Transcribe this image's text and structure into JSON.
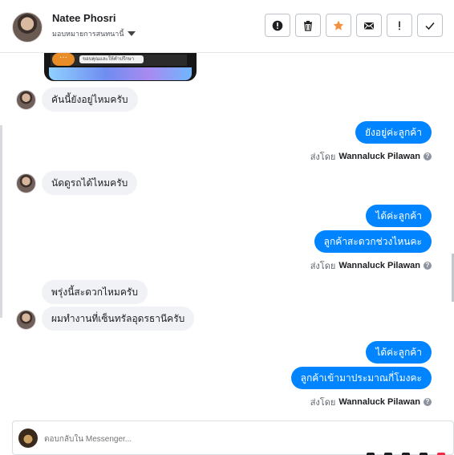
{
  "header": {
    "name": "Natee Phosri",
    "assign_label": "มอบหมายการสนทนานี้",
    "actions": [
      {
        "name": "report-icon",
        "glyph": "!"
      },
      {
        "name": "trash-icon"
      },
      {
        "name": "star-icon",
        "color": "#f5913e"
      },
      {
        "name": "mail-icon"
      },
      {
        "name": "exclamation-icon",
        "glyph": "!"
      },
      {
        "name": "check-icon"
      }
    ]
  },
  "thread": {
    "image_preview": {
      "chip_text": "ขอบคุณและให้คำปรึกษา"
    },
    "messages": [
      {
        "side": "in",
        "text": "คันนี้ยังอยู่ไหมครับ",
        "avatar": true
      },
      {
        "side": "out",
        "text": "ยังอยู่ค่ะลูกค้า"
      },
      {
        "side": "sent_by",
        "prefix": "ส่งโดย",
        "who": "Wannaluck Pilawan"
      },
      {
        "side": "in",
        "text": "นัดดูรถได้ไหมครับ",
        "avatar": true
      },
      {
        "side": "out",
        "text": "ได้ค่ะลูกค้า"
      },
      {
        "side": "out",
        "text": "ลูกค้าสะดวกช่วงไหนคะ"
      },
      {
        "side": "sent_by",
        "prefix": "ส่งโดย",
        "who": "Wannaluck Pilawan"
      },
      {
        "side": "in",
        "text": "พรุ่งนี้สะดวกไหมครับ",
        "avatar": false
      },
      {
        "side": "in",
        "text": "ผมทำงานที่เซ็นทรัลอุดรธานีครับ",
        "avatar": true
      },
      {
        "side": "out",
        "text": "ได้ค่ะลูกค้า"
      },
      {
        "side": "out",
        "text": "ลูกค้าเข้ามาประมาณกี่โมงคะ"
      },
      {
        "side": "sent_by",
        "prefix": "ส่งโดย",
        "who": "Wannaluck Pilawan"
      }
    ]
  },
  "composer": {
    "placeholder": "ตอบกลับใน Messenger..."
  },
  "colors": {
    "outgoing_bubble": "#0084ff",
    "incoming_bubble": "#f0f2f5",
    "star": "#f5913e"
  }
}
